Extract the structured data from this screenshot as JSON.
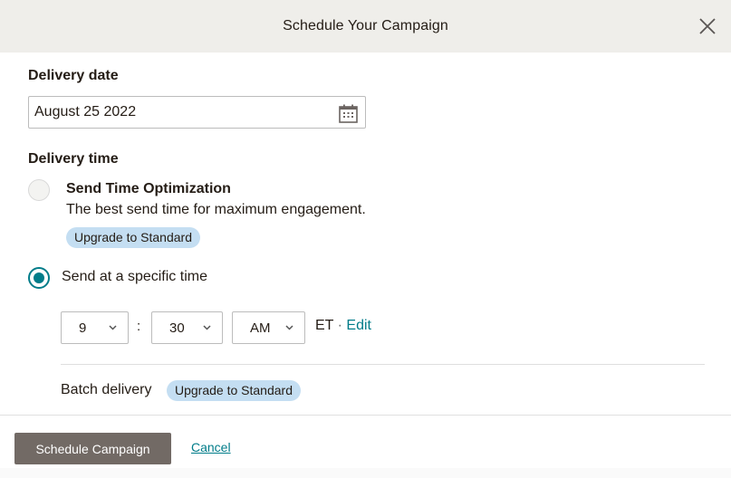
{
  "header": {
    "title": "Schedule Your Campaign",
    "close_icon": "close-icon"
  },
  "delivery_date": {
    "label": "Delivery date",
    "value": "August 25 2022",
    "icon": "calendar-icon"
  },
  "delivery_time": {
    "label": "Delivery time",
    "options": [
      {
        "title": "Send Time Optimization",
        "description": "The best send time for maximum engagement.",
        "badge": "Upgrade to Standard",
        "selected": false
      },
      {
        "title": "Send at a specific time",
        "selected": true
      }
    ],
    "hour": "9",
    "separator": ":",
    "minute": "30",
    "meridiem": "AM",
    "timezone": "ET",
    "timezone_separator": "·",
    "edit_label": "Edit"
  },
  "batch": {
    "label": "Batch delivery",
    "badge": "Upgrade to Standard"
  },
  "footer": {
    "primary_label": "Schedule Campaign",
    "cancel_label": "Cancel"
  },
  "colors": {
    "accent": "#007c89",
    "header_bg": "#efeeea",
    "badge_bg": "#c4def2",
    "primary_button": "#726a65"
  }
}
